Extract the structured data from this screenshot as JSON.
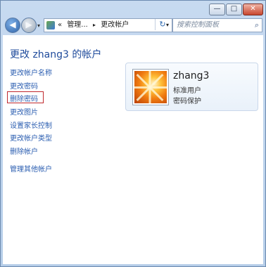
{
  "window": {
    "min_glyph": "—",
    "max_glyph": "□",
    "close_glyph": "✕"
  },
  "nav": {
    "back_glyph": "◀",
    "forward_glyph": "▶",
    "history_glyph": "▾"
  },
  "address": {
    "prefix": "«",
    "crumb1": "管理...",
    "sep": "▸",
    "crumb2": "更改帐户",
    "dropdown_glyph": "▾",
    "refresh_glyph": "↻"
  },
  "search": {
    "placeholder": "搜索控制面板",
    "icon": "search-icon",
    "glyph": "⌕"
  },
  "page": {
    "title": "更改 zhang3 的帐户"
  },
  "tasks": [
    {
      "label": "更改帐户名称",
      "highlighted": false
    },
    {
      "label": "更改密码",
      "highlighted": false
    },
    {
      "label": "删除密码",
      "highlighted": true
    },
    {
      "label": "更改图片",
      "highlighted": false
    },
    {
      "label": "设置家长控制",
      "highlighted": false
    },
    {
      "label": "更改帐户类型",
      "highlighted": false
    },
    {
      "label": "删除帐户",
      "highlighted": false
    }
  ],
  "other_link": "管理其他帐户",
  "account": {
    "name": "zhang3",
    "type": "标准用户",
    "status": "密码保护"
  },
  "colors": {
    "link": "#2a5db0",
    "title": "#1e4a9b",
    "highlight_border": "#c0282d"
  }
}
